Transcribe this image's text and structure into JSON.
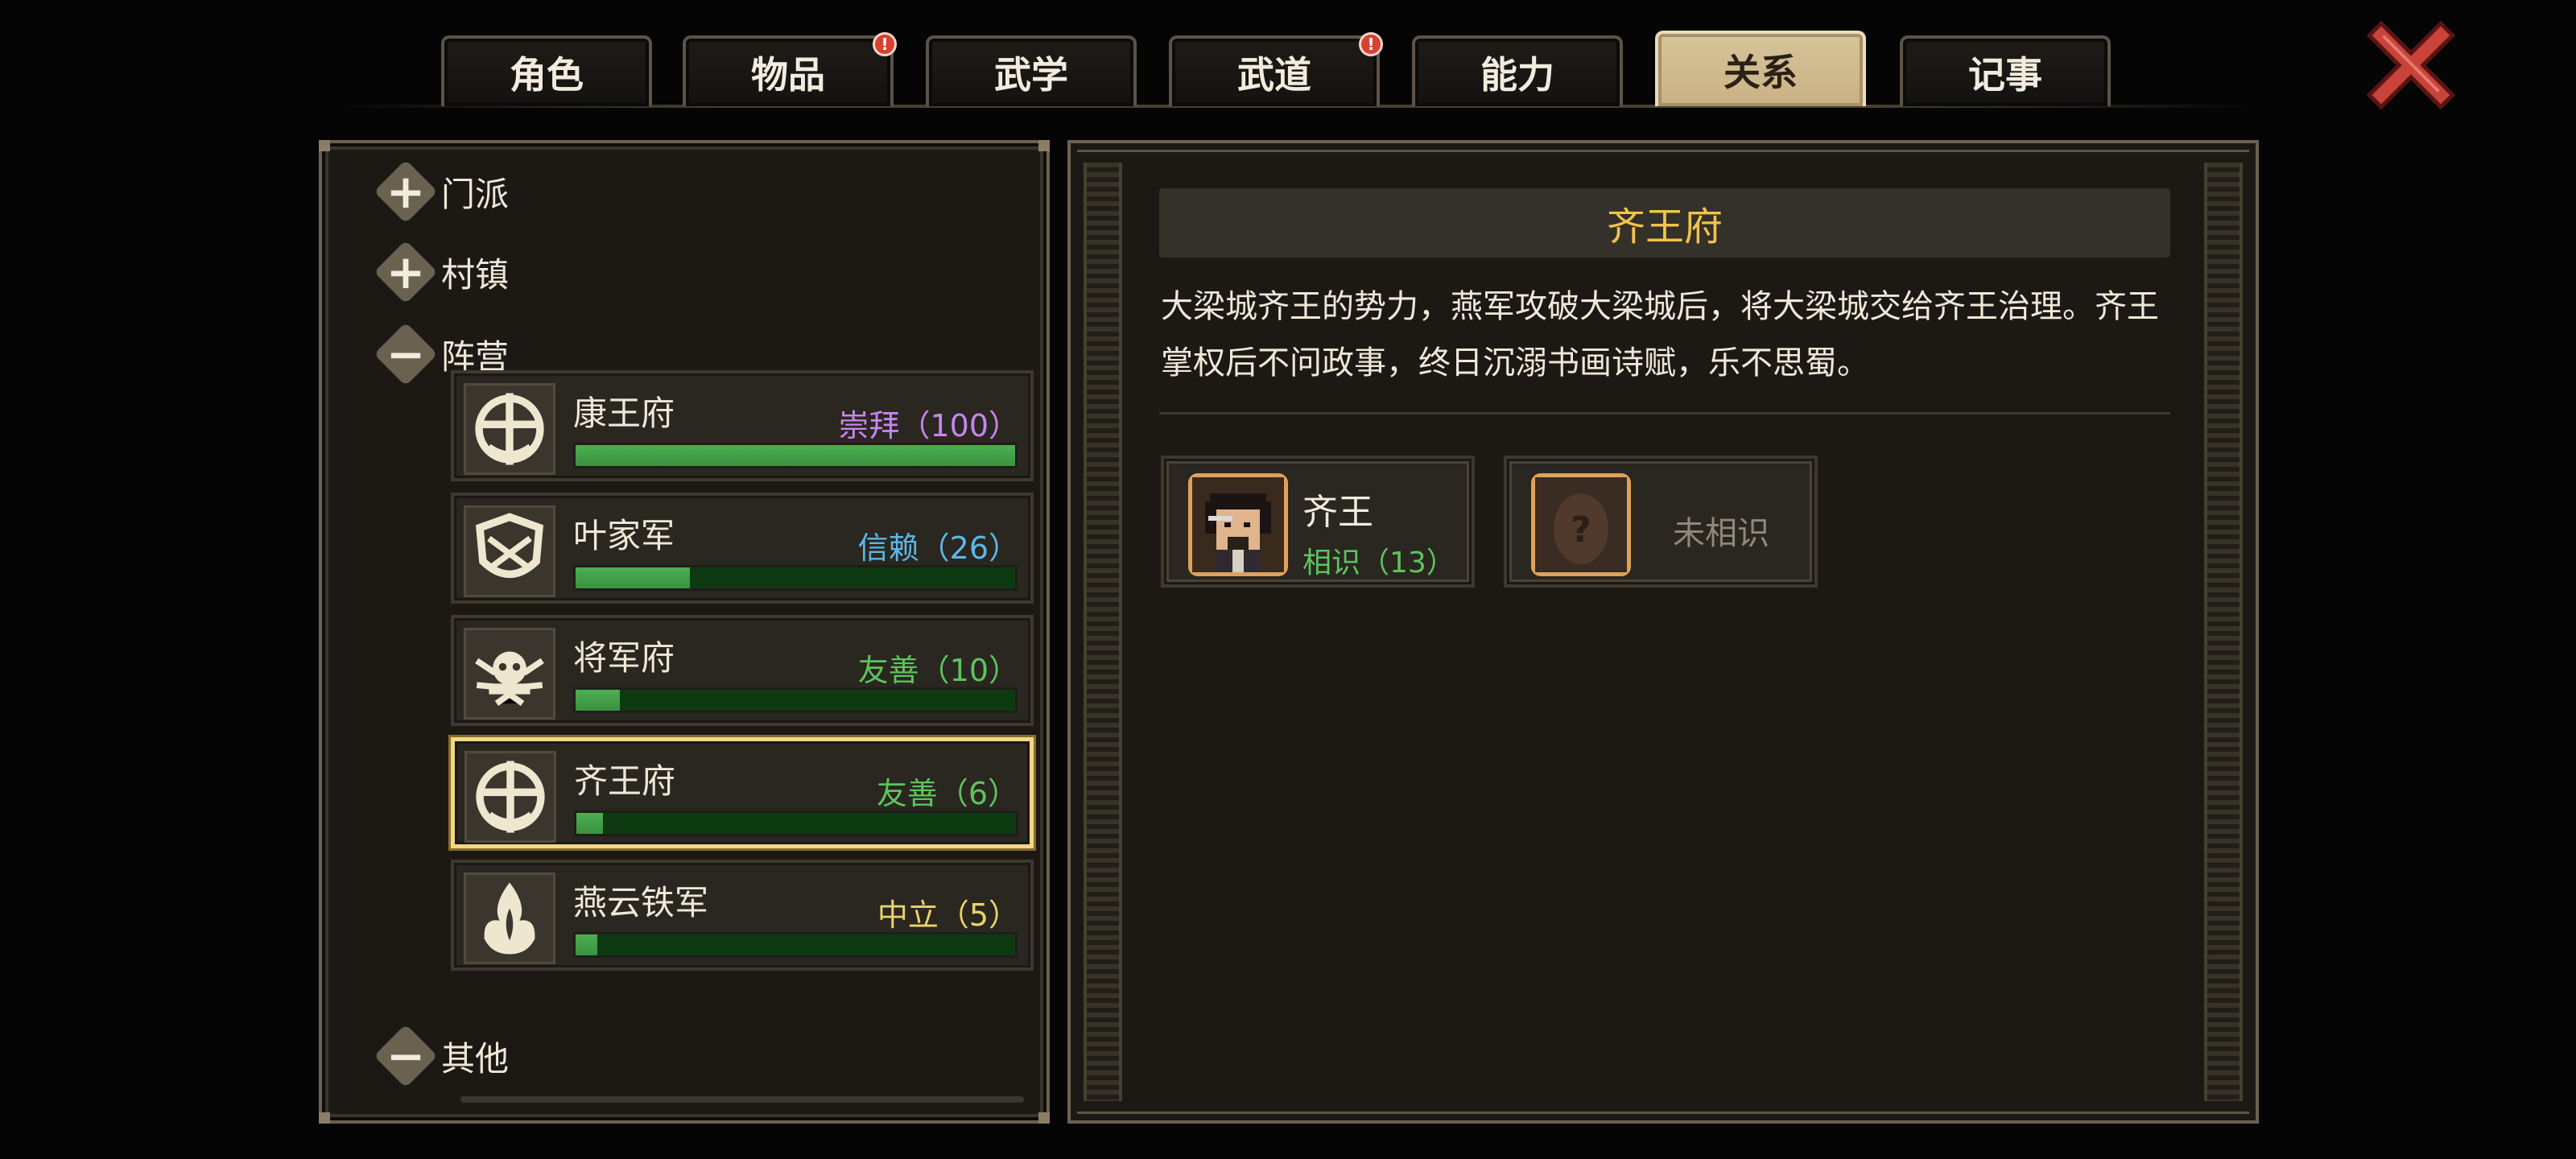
{
  "tabs": [
    {
      "label": "角色",
      "badge": ""
    },
    {
      "label": "物品",
      "badge": "!"
    },
    {
      "label": "武学",
      "badge": ""
    },
    {
      "label": "武道",
      "badge": "!"
    },
    {
      "label": "能力",
      "badge": ""
    },
    {
      "label": "关系",
      "badge": ""
    },
    {
      "label": "记事",
      "badge": ""
    }
  ],
  "active_tab": "关系",
  "groups": {
    "sect": {
      "label": "门派",
      "state": "collapsed",
      "symbol": "+"
    },
    "town": {
      "label": "村镇",
      "state": "collapsed",
      "symbol": "+"
    },
    "camp": {
      "label": "阵营",
      "state": "expanded",
      "symbol": "−"
    },
    "other": {
      "label": "其他",
      "state": "expanded",
      "symbol": "−"
    }
  },
  "factions": [
    {
      "name": "康王府",
      "standing": "崇拜（100）",
      "standing_color": "#c486ef",
      "progress": 1.0,
      "emblem": "wheel-emblem-icon"
    },
    {
      "name": "叶家军",
      "standing": "信赖（26）",
      "standing_color": "#5bb8e8",
      "progress": 0.26,
      "emblem": "shield-emblem-icon"
    },
    {
      "name": "将军府",
      "standing": "友善（10）",
      "standing_color": "#5cc45e",
      "progress": 0.1,
      "emblem": "beast-emblem-icon"
    },
    {
      "name": "齐王府",
      "standing": "友善（6）",
      "standing_color": "#5cc45e",
      "progress": 0.06,
      "emblem": "wheel-emblem-icon"
    },
    {
      "name": "燕云铁军",
      "standing": "中立（5）",
      "standing_color": "#e9d46a",
      "progress": 0.05,
      "emblem": "flame-emblem-icon"
    }
  ],
  "selected_faction": "齐王府",
  "detail": {
    "title": "齐王府",
    "description": "大梁城齐王的势力，燕军攻破大梁城后，将大梁城交给齐王治理。齐王掌权后不问政事，终日沉溺书画诗赋，乐不思蜀。",
    "npcs": [
      {
        "name": "齐王",
        "status": "相识（13）",
        "known": true
      },
      {
        "name": "",
        "status": "未相识",
        "known": false,
        "portrait_symbol": "?"
      }
    ]
  },
  "colors": {
    "accent_gold": "#f0c44a",
    "active_tab_bg": "#d8c49a",
    "selected_border": "#f1d884",
    "bar_fill": "#4caf52",
    "bar_track": "#0d3a10",
    "close_red": "#c8433a"
  }
}
